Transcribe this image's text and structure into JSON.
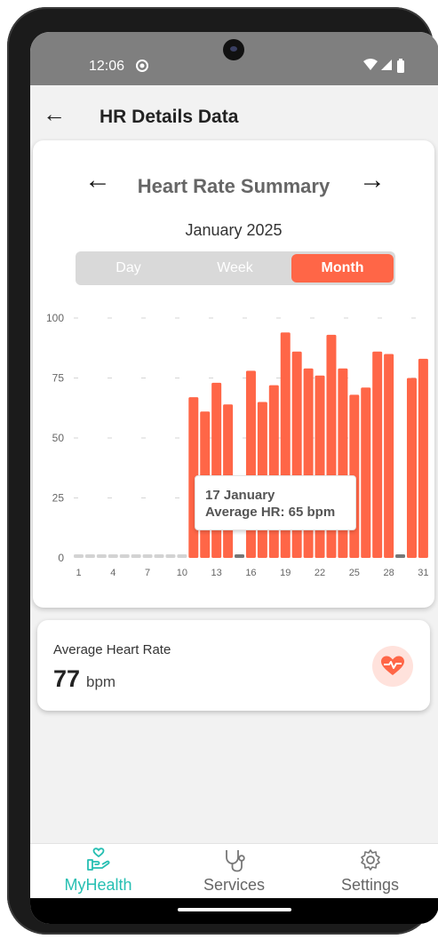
{
  "status_bar": {
    "time": "12:06",
    "icons": [
      "alarm-icon",
      "wifi-icon",
      "signal-icon",
      "battery-icon"
    ]
  },
  "header": {
    "title": "HR Details Data",
    "back_icon": "arrow-left-icon"
  },
  "summary": {
    "title": "Heart Rate Summary",
    "period": "January 2025",
    "prev_icon": "arrow-left-icon",
    "next_icon": "arrow-right-icon",
    "tabs": [
      {
        "label": "Day",
        "active": false
      },
      {
        "label": "Week",
        "active": false
      },
      {
        "label": "Month",
        "active": true
      }
    ]
  },
  "tooltip": {
    "line1": "17 January",
    "line2": "Average HR: 65 bpm"
  },
  "chart_data": {
    "type": "bar",
    "x": [
      1,
      2,
      3,
      4,
      5,
      6,
      7,
      8,
      9,
      10,
      11,
      12,
      13,
      14,
      15,
      16,
      17,
      18,
      19,
      20,
      21,
      22,
      23,
      24,
      25,
      26,
      27,
      28,
      29,
      30,
      31
    ],
    "values": [
      0,
      0,
      0,
      0,
      0,
      0,
      0,
      0,
      0,
      0,
      67,
      61,
      73,
      64,
      0,
      78,
      65,
      72,
      94,
      86,
      79,
      76,
      93,
      79,
      68,
      71,
      86,
      85,
      0,
      75,
      83
    ],
    "xticks": [
      "1",
      "4",
      "7",
      "10",
      "13",
      "16",
      "19",
      "22",
      "25",
      "28",
      "31"
    ],
    "yticks": [
      "0",
      "25",
      "50",
      "75",
      "100"
    ],
    "ylim": [
      0,
      100
    ],
    "grid": "dashed",
    "colors": {
      "bar": "#ff6647",
      "empty": "#d3d3d3",
      "selected_empty": "#777777"
    }
  },
  "average": {
    "label": "Average Heart Rate",
    "value": "77",
    "unit": "bpm",
    "icon": "heart-pulse-icon"
  },
  "bottom_nav": [
    {
      "label": "MyHealth",
      "icon": "hand-heart-icon",
      "active": true
    },
    {
      "label": "Services",
      "icon": "stethoscope-icon",
      "active": false
    },
    {
      "label": "Settings",
      "icon": "gear-icon",
      "active": false
    }
  ],
  "colors": {
    "accent": "#ff6647",
    "teal": "#26bfb2"
  }
}
